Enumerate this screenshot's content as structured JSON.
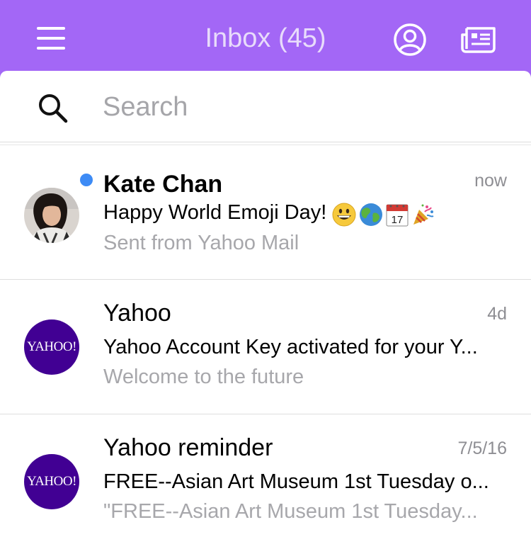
{
  "header": {
    "title": "Inbox (45)",
    "background_color": "#a367f6",
    "menu_icon": "hamburger-menu-icon",
    "profile_icon": "profile-icon",
    "news_icon": "newspaper-icon"
  },
  "search": {
    "placeholder": "Search",
    "icon": "search-icon"
  },
  "messages": [
    {
      "sender": "Kate Chan",
      "time": "now",
      "subject": "Happy World Emoji Day!",
      "subject_emojis": [
        "grinning-face-emoji",
        "globe-emoji",
        "calendar-emoji",
        "party-popper-emoji"
      ],
      "calendar_day": "17",
      "preview": "Sent from Yahoo Mail",
      "unread": true,
      "avatar": "photo"
    },
    {
      "sender": "Yahoo",
      "time": "4d",
      "subject": "Yahoo Account Key activated for your Y...",
      "preview": "Welcome to the future",
      "unread": false,
      "avatar_text": "YAHOO!"
    },
    {
      "sender": "Yahoo reminder",
      "time": "7/5/16",
      "subject": "FREE--Asian Art Museum 1st Tuesday o...",
      "preview": "\"FREE--Asian Art Museum 1st Tuesday...",
      "unread": false,
      "avatar_text": "YAHOO!"
    }
  ],
  "colors": {
    "accent": "#a367f6",
    "unread_dot": "#3d8bf5",
    "yahoo_purple": "#410093"
  }
}
